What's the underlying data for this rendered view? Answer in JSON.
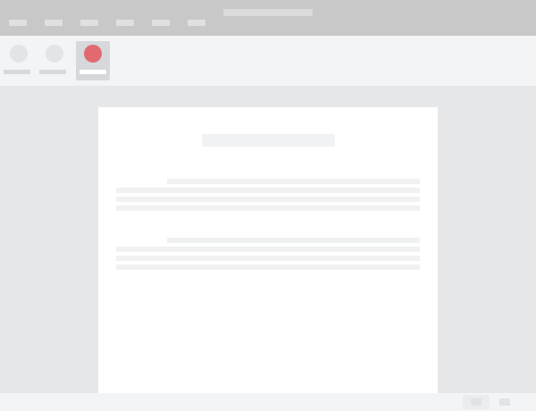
{
  "menu": {
    "items": [
      "",
      "",
      "",
      "",
      "",
      ""
    ]
  },
  "window": {
    "title": ""
  },
  "ribbon": {
    "tools": [
      {
        "icon": "circle-icon",
        "label": "",
        "active": false
      },
      {
        "icon": "circle-icon",
        "label": "",
        "active": false
      },
      {
        "icon": "record-icon",
        "label": "",
        "active": true
      }
    ],
    "active_color": "#e06a70"
  },
  "document": {
    "title": "",
    "paragraphs": [
      {
        "lines": [
          "",
          "",
          "",
          ""
        ]
      },
      {
        "lines": [
          "",
          "",
          "",
          ""
        ]
      }
    ]
  },
  "status": {
    "view_buttons": [
      "",
      ""
    ]
  }
}
